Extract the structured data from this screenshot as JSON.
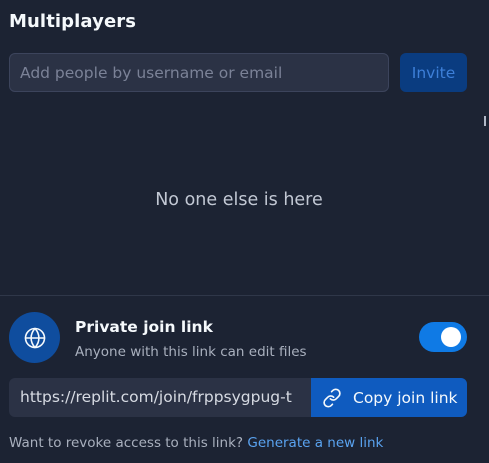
{
  "header": {
    "title": "Multiplayers"
  },
  "invite": {
    "placeholder": "Add people by username or email",
    "value": "",
    "button_label": "Invite"
  },
  "members": {
    "empty_message": "No one else is here"
  },
  "join_link": {
    "icon": "globe-icon",
    "title": "Private join link",
    "subtitle": "Anyone with this link can edit files",
    "enabled": true,
    "url": "https://replit.com/join/frppsygpug-t",
    "copy_icon": "link-icon",
    "copy_label": "Copy join link",
    "revoke_text": "Want to revoke access to this link?",
    "revoke_link_label": "Generate a new link"
  },
  "colors": {
    "background": "#1c2333",
    "input_background": "#2b3245",
    "accent": "#0f7ae5",
    "link": "#5aa3f0"
  }
}
